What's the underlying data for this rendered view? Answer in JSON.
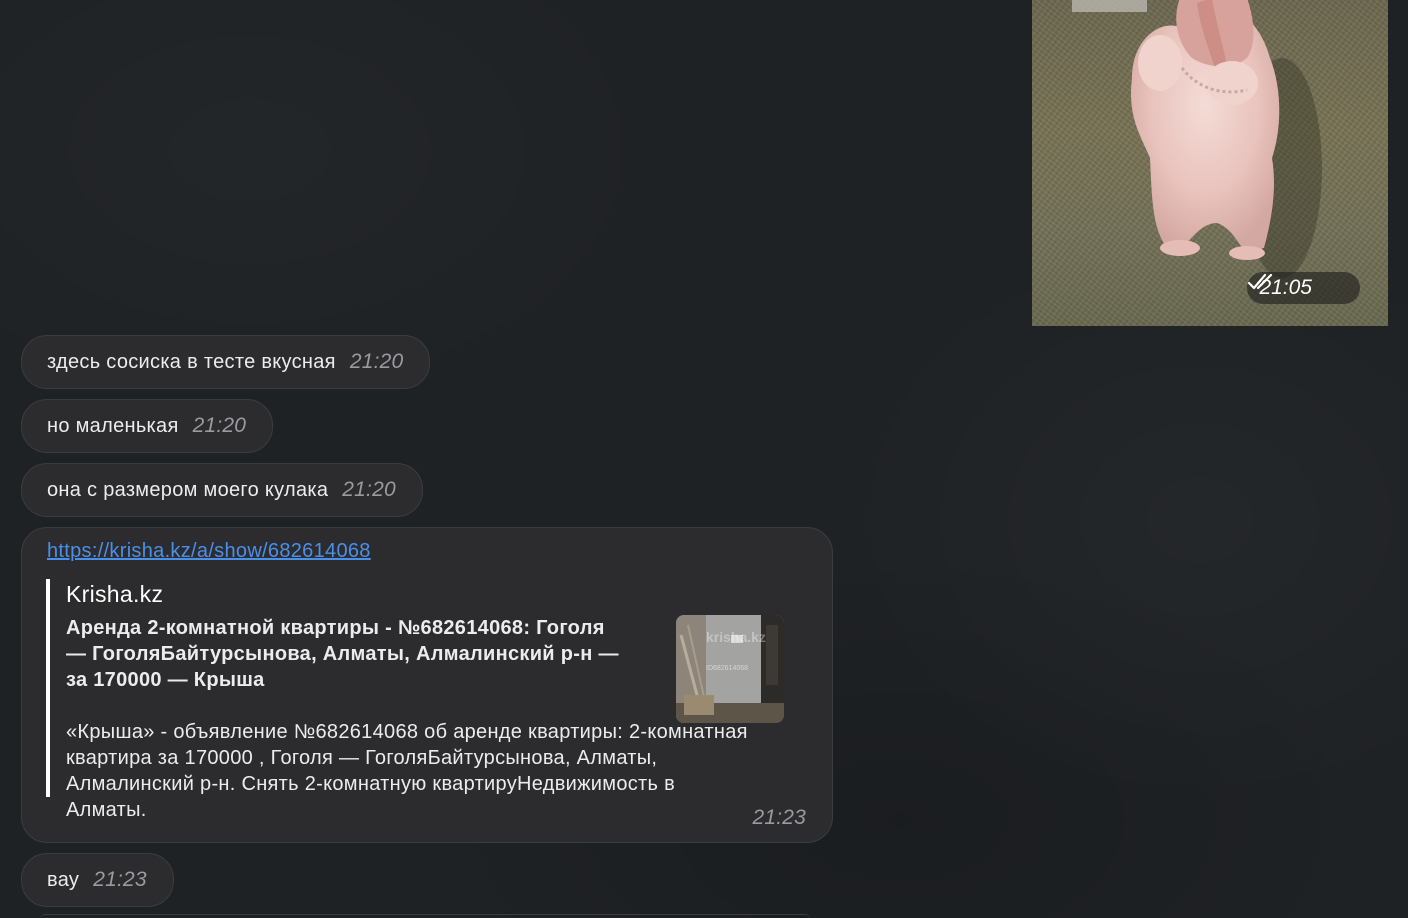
{
  "photo_message": {
    "time": "21:05",
    "status_icon": "double-check-icon"
  },
  "messages": [
    {
      "text": "здесь сосиска в тесте вкусная",
      "time": "21:20"
    },
    {
      "text": "но маленькая",
      "time": "21:20"
    },
    {
      "text": "она с размером моего кулака",
      "time": "21:20"
    }
  ],
  "link_message": {
    "url": "https://krisha.kz/a/show/682614068",
    "preview": {
      "site": "Krisha.kz",
      "title": "Аренда 2-комнатной квартиры - №682614068: Гоголя — ГоголяБайтурсынова, Алматы, Алмалинский р-н — за 170000 — Крыша",
      "description": "«Крыша» - объявление №682614068 об аренде квартиры: 2-комнатная квартира за 170000 , Гоголя — ГоголяБайтурсынова, Алматы, Алмалинский р-н. Снять 2-комнатную квартируНедвижимость в Алматы.",
      "thumb_watermark": "krisha.kz",
      "thumb_id": "ID682614068"
    },
    "time": "21:23"
  },
  "last_message": {
    "text": "вау",
    "time": "21:23"
  }
}
